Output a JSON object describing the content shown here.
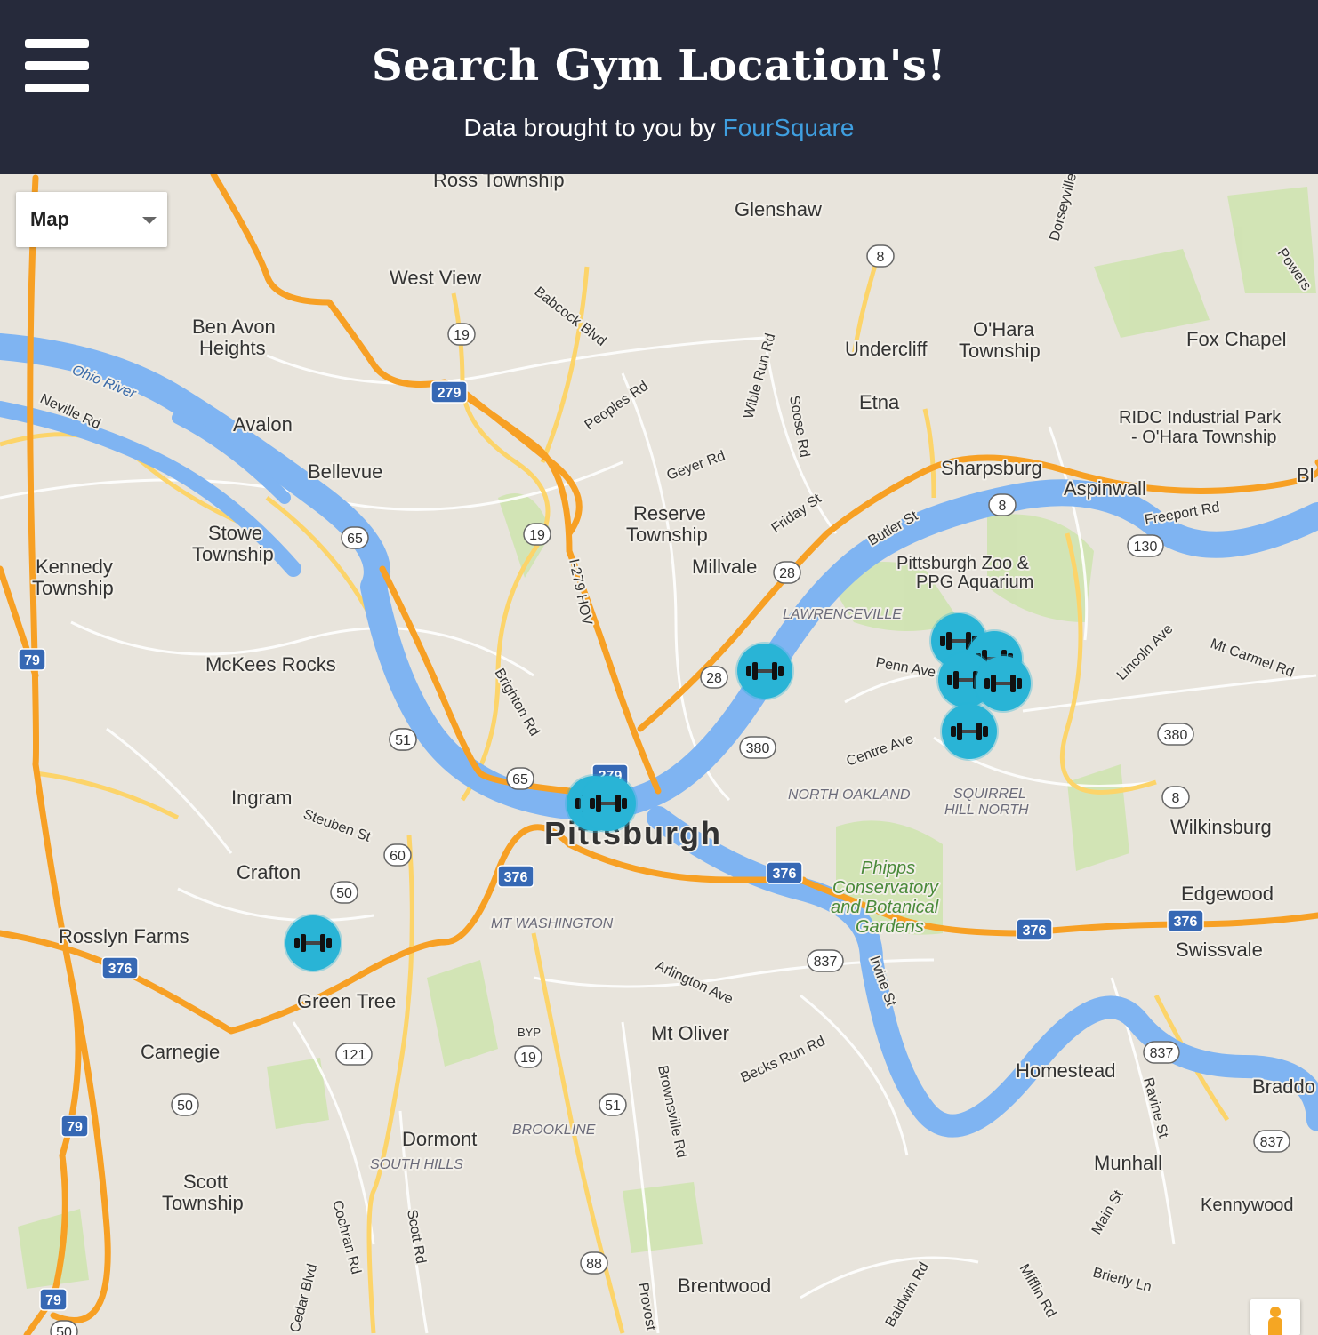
{
  "header": {
    "title": "Search Gym Location's!",
    "subtitle_prefix": "Data brought to you by",
    "subtitle_link": "FourSquare"
  },
  "map_controls": {
    "map_type": "Map",
    "pegman_icon": "pegman-icon"
  },
  "map_labels": {
    "ross_township": "Ross Township",
    "glenshaw": "Glenshaw",
    "west_view": "West View",
    "ben_avon_1": "Ben Avon",
    "ben_avon_2": "Heights",
    "babcock": "Babcock Blvd",
    "ohio_river": "Ohio River",
    "neville_rd": "Neville Rd",
    "avalon": "Avalon",
    "bellevue": "Bellevue",
    "peoples_rd": "Peoples Rd",
    "wible": "Wible Run Rd",
    "soose": "Soose Rd",
    "undercliff": "Undercliff",
    "ohara_1": "O'Hara",
    "ohara_2": "Township",
    "etna": "Etna",
    "fox_chapel": "Fox Chapel",
    "ridc_1": "RIDC Industrial Park",
    "ridc_2": "- O'Hara Township",
    "geyer": "Geyer Rd",
    "sharpsburg": "Sharpsburg",
    "aspinwall": "Aspinwall",
    "freeport": "Freeport Rd",
    "reserve_1": "Reserve",
    "reserve_2": "Township",
    "friday": "Friday St",
    "butler": "Butler St",
    "stowe_1": "Stowe",
    "stowe_2": "Township",
    "kennedy_1": "Kennedy",
    "kennedy_2": "Township",
    "millvale": "Millvale",
    "zoo_1": "Pittsburgh Zoo &",
    "zoo_2": "PPG Aquarium",
    "lawrenceville": "LAWRENCEVILLE",
    "i279hov": "I-279 HOV",
    "mckees": "McKees Rocks",
    "penn": "Penn Ave",
    "lincoln": "Lincoln Ave",
    "mtcarmel": "Mt Carmel Rd",
    "brighton": "Brighton Rd",
    "centre": "Centre Ave",
    "ingram": "Ingram",
    "steuben": "Steuben St",
    "north_oakland": "NORTH OAKLAND",
    "squirrel_1": "SQUIRREL",
    "squirrel_2": "HILL NORTH",
    "wilkinsburg": "Wilkinsburg",
    "pittsburgh": "Pittsburgh",
    "crafton": "Crafton",
    "phipps_1": "Phipps",
    "phipps_2": "Conservatory",
    "phipps_3": "and Botanical",
    "phipps_4": "Gardens",
    "edgewood": "Edgewood",
    "mt_washington": "MT WASHINGTON",
    "rosslyn": "Rosslyn Farms",
    "swissvale": "Swissvale",
    "arlington": "Arlington Ave",
    "irvine": "Irvine St",
    "green_tree": "Green Tree",
    "carnegie": "Carnegie",
    "mt_oliver": "Mt Oliver",
    "becks": "Becks Run Rd",
    "homestead": "Homestead",
    "braddock": "Braddo",
    "ravine": "Ravine St",
    "brownsville": "Brownsville Rd",
    "brookline": "BROOKLINE",
    "dormont": "Dormont",
    "south_hills": "SOUTH HILLS",
    "munhall": "Munhall",
    "scott_1": "Scott",
    "scott_2": "Township",
    "kennywood": "Kennywood",
    "main_st": "Main St",
    "cochran": "Cochran Rd",
    "scott_rd": "Scott Rd",
    "cedar": "Cedar Blvd",
    "brierly": "Brierly Ln",
    "baldwin": "Baldwin Rd",
    "mifflin": "Mifflin Rd",
    "provost": "Provost",
    "brentwood": "Brentwood",
    "byp": "BYP",
    "bl_edge": "Bl",
    "powers": "Powers",
    "dorseyville": "Dorseyville"
  },
  "route_shields": [
    "8",
    "19",
    "279",
    "51",
    "65",
    "19",
    "28",
    "28",
    "8",
    "130",
    "380",
    "79",
    "51",
    "65",
    "279",
    "380",
    "8",
    "60",
    "376",
    "376",
    "50",
    "376",
    "376",
    "837",
    "376",
    "19",
    "121",
    "50",
    "51",
    "837",
    "837",
    "79",
    "88",
    "79",
    "50"
  ],
  "markers": [
    {
      "icon": "dumbbell-icon",
      "name": "gym-marker-strip-district"
    },
    {
      "icon": "dumbbell-icon",
      "name": "gym-marker-downtown-1"
    },
    {
      "icon": "dumbbell-icon",
      "name": "gym-marker-downtown-2"
    },
    {
      "icon": "dumbbell-icon",
      "name": "gym-marker-crafton"
    },
    {
      "icon": "dumbbell-icon",
      "name": "gym-marker-liberty-1"
    },
    {
      "icon": "dumbbell-icon",
      "name": "gym-marker-liberty-2"
    },
    {
      "icon": "dumbbell-icon",
      "name": "gym-marker-liberty-3"
    },
    {
      "icon": "dumbbell-icon",
      "name": "gym-marker-liberty-4"
    },
    {
      "icon": "dumbbell-icon",
      "name": "gym-marker-shadyside"
    }
  ],
  "colors": {
    "header_bg": "#262a3b",
    "link": "#3f9fe0",
    "marker": "#29b4d6",
    "river": "#7fb4f2",
    "highway": "#f7a024",
    "park": "#c8dfa8"
  }
}
